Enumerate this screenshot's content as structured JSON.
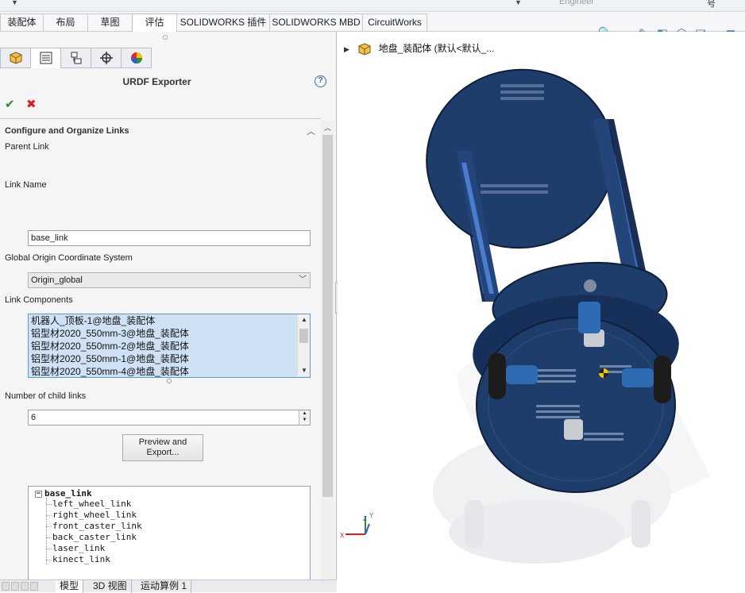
{
  "top_strip": {
    "label": "Engineer",
    "trailing": "号"
  },
  "command_tabs": [
    {
      "label": "装配体"
    },
    {
      "label": "布局"
    },
    {
      "label": "草图"
    },
    {
      "label": "评估"
    },
    {
      "label": "SOLIDWORKS 插件"
    },
    {
      "label": "SOLIDWORKS MBD"
    },
    {
      "label": "CircuitWorks"
    }
  ],
  "view_toolbar": {
    "icons": [
      "zoom-to-fit-icon",
      "zoom-area-icon",
      "previous-view-icon",
      "section-view-icon",
      "view-orientation-icon",
      "display-style-icon",
      "hide-show-icon"
    ]
  },
  "panel_tabs": [
    "feature-manager-icon",
    "property-manager-icon",
    "configuration-manager-icon",
    "dimxpert-icon",
    "display-manager-icon"
  ],
  "panel": {
    "title": "URDF Exporter",
    "help": "?",
    "ok": "✔",
    "cancel": "✖",
    "section_title": "Configure and Organize Links",
    "parent_link_label": "Parent Link",
    "link_name_label": "Link Name",
    "link_name_value": "base_link",
    "coord_label": "Global Origin Coordinate System",
    "coord_value": "Origin_global",
    "components_label": "Link Components",
    "components": [
      "机器人_顶板-1@地盘_装配体",
      "铝型材2020_550mm-3@地盘_装配体",
      "铝型材2020_550mm-2@地盘_装配体",
      "铝型材2020_550mm-1@地盘_装配体",
      "铝型材2020_550mm-4@地盘_装配体"
    ],
    "child_count_label": "Number of child links",
    "child_count_value": "6",
    "preview_button_line1": "Preview and",
    "preview_button_line2": "Export...",
    "tree": {
      "root": "base_link",
      "children": [
        "left_wheel_link",
        "right_wheel_link",
        "front_caster_link",
        "back_caster_link",
        "laser_link",
        "kinect_link"
      ]
    }
  },
  "bottom_tabs": [
    {
      "label": "模型"
    },
    {
      "label": "3D 视图"
    },
    {
      "label": "运动算例 1"
    }
  ],
  "viewport": {
    "feature_tree_root": "地盘_装配体  (默认<默认_..."
  },
  "colors": {
    "accent": "#3b6aa8",
    "ok": "#2e8b2e",
    "cancel": "#d42020",
    "model": "#1f3d6b"
  }
}
